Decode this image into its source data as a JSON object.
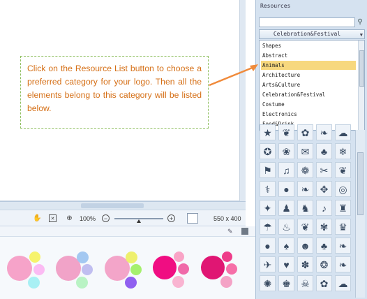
{
  "callout": {
    "text": "Click on the Resource List button to choose a preferred category for your logo. Then all the elements belong to this category will be listed below."
  },
  "zoom_bar": {
    "zoom_value": "100%",
    "canvas_size": "550 x 400",
    "icons": [
      "hand-icon",
      "fit-icon",
      "actual-size-icon",
      "zoom-out-icon",
      "zoom-in-icon"
    ]
  },
  "resources": {
    "title": "Resources",
    "search_value": "",
    "selected_category": "Celebration&Festival",
    "categories": [
      "Shapes",
      "Abstract",
      "Animals",
      "Architecture",
      "Arts&Culture",
      "Celebration&Festival",
      "Costume",
      "Electronics",
      "Food&Drink"
    ],
    "highlighted": "Animals",
    "tile_icons": [
      "star-shape",
      "leaf-shape",
      "flower-shape",
      "bird-shape",
      "ghost-shape",
      "badge-shape",
      "bow-icon",
      "gift-icon",
      "tree-icon",
      "snowflake-icon",
      "banner-icon",
      "bell-icon",
      "wreath-icon",
      "bow-icon",
      "holly-icon",
      "cane-icon",
      "balloon-icon",
      "leaf-icon",
      "holly-icon",
      "target-icon",
      "ornament-icon",
      "angel-icon",
      "reindeer-icon",
      "bells-icon",
      "shirt-icon",
      "sleigh-icon",
      "candle-icon",
      "bird-icon",
      "leaf-icon",
      "lantern-icon",
      "egg-icon",
      "pumpkin-icon",
      "mask-icon",
      "cat-icon",
      "bird-icon",
      "bat-icon",
      "heart-icon",
      "holly-icon",
      "ornament-icon",
      "fish-icon",
      "spider-icon",
      "hat-icon",
      "skull-icon",
      "wreath-icon",
      "blob-icon"
    ]
  },
  "color_schemes": [
    {
      "name": "scheme-1",
      "colors": [
        "#f6a3c9",
        "#f6f36c",
        "#fbbbf3",
        "#a8f0f4"
      ]
    },
    {
      "name": "scheme-2",
      "colors": [
        "#f1a3c8",
        "#a3c8f1",
        "#c0bef0",
        "#b9f3c4"
      ]
    },
    {
      "name": "scheme-3",
      "colors": [
        "#f3a5c9",
        "#eef06d",
        "#a5f06d",
        "#9060f0"
      ]
    },
    {
      "name": "scheme-4",
      "colors": [
        "#f00d82",
        "#f9a4c6",
        "#f06aa9",
        "#f9b4d1"
      ]
    },
    {
      "name": "scheme-5",
      "colors": [
        "#e01673",
        "#ee3c89",
        "#f66fa8",
        "#f4a3c6"
      ]
    }
  ]
}
